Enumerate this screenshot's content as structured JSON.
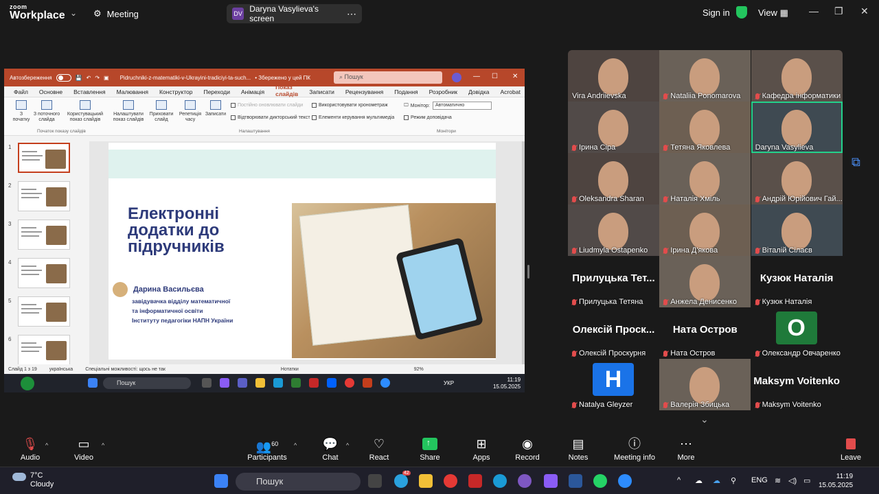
{
  "zoom": {
    "logo_top": "zoom",
    "logo_bottom": "Workplace",
    "meeting_label": "Meeting",
    "share_initials": "DV",
    "share_label": "Daryna Vasylieva's screen",
    "sign_in": "Sign in",
    "view_label": "View"
  },
  "ppt": {
    "autosave": "Автозбереження",
    "doc_title": "Pidruchniki-z-matematiki-v-Ukrayini-tradiciyi-ta-such...",
    "saved": "• Збережено у цей ПК",
    "search": "Пошук",
    "avatar": "ДВ",
    "tabs": [
      "Файл",
      "Основне",
      "Вставлення",
      "Малювання",
      "Конструктор",
      "Переходи",
      "Анімація",
      "Показ слайдів",
      "Записати",
      "Рецензування",
      "Подання",
      "Розробник",
      "Довідка",
      "Acrobat"
    ],
    "active_tab": "Показ слайдів",
    "ribbon": {
      "btn_start": "З початку",
      "btn_current": "З поточного слайда",
      "btn_custom": "Користувацький показ слайдів",
      "btn_setup": "Налаштувати показ слайдів",
      "btn_hide": "Приховати слайд",
      "btn_rehearse": "Репетиція часу",
      "btn_record": "Записати",
      "chk_loop": "Постійно оновлювати слайди",
      "chk_timings": "Використовувати хронометраж",
      "chk_narration": "Відтворювати дикторський текст",
      "chk_media": "Елементи керування мультимедіа",
      "monitor_label": "Монітор:",
      "monitor_value": "Автоматично",
      "presenter": "Режим доповідача",
      "grp_start": "Початок показу слайдів",
      "grp_setup": "Налаштування",
      "grp_monitors": "Монітори"
    },
    "thumbs": [
      "1",
      "2",
      "3",
      "4",
      "5",
      "6"
    ],
    "slide": {
      "title_l1": "Електронні",
      "title_l2": "додатки до",
      "title_l3": "підручників",
      "author": "Дарина Васильєва",
      "desc_l1": "завідувачка відділу математичної",
      "desc_l2": "та інформатичної освіти",
      "desc_l3": "Інституту педагогіки НАПН України"
    },
    "status": {
      "slide_count": "Слайд 1 з 19",
      "language": "українська",
      "accessibility": "Спеціальні можливості: щось не так",
      "notes": "Нотатки",
      "zoom": "92%"
    },
    "taskbar": {
      "search": "Пошук",
      "lang": "УКР",
      "time": "11:19",
      "date": "15.05.2025"
    }
  },
  "participants": [
    {
      "name": "Vira Andriievska",
      "type": "photo",
      "muted": false
    },
    {
      "name": "Nataliia Ponomarova",
      "type": "photo",
      "muted": true
    },
    {
      "name": "Кафедра інформатики",
      "type": "photo",
      "muted": true
    },
    {
      "name": "Ірина Сіра",
      "type": "photo",
      "muted": true
    },
    {
      "name": "Тетяна Яковлева",
      "type": "photo",
      "muted": true
    },
    {
      "name": "Daryna Vasylieva",
      "type": "photo",
      "muted": false
    },
    {
      "name": "Oleksandra Sharan",
      "type": "photo",
      "muted": true
    },
    {
      "name": "Наталія Хміль",
      "type": "photo",
      "muted": true
    },
    {
      "name": "Андрій Юрійович Гай...",
      "type": "photo",
      "muted": true
    },
    {
      "name": "Liudmyla Ostapenko",
      "type": "photo",
      "muted": true
    },
    {
      "name": "Ірина Д'якова",
      "type": "photo",
      "muted": true
    },
    {
      "name": "Віталій Сілаєв",
      "type": "photo",
      "muted": true
    },
    {
      "name": "Прилуцька Тетяна",
      "type": "text",
      "big": "Прилуцька Тет...",
      "muted": true
    },
    {
      "name": "Анжела Денисенко",
      "type": "photo",
      "muted": true
    },
    {
      "name": "Кузюк Наталія",
      "type": "text",
      "big": "Кузюк Наталія",
      "muted": true
    },
    {
      "name": "Олексій Проскурня",
      "type": "text",
      "big": "Олексій Проск...",
      "muted": true
    },
    {
      "name": "Ната Остров",
      "type": "text",
      "big": "Ната Остров",
      "muted": true
    },
    {
      "name": "Олександр Овчаренко",
      "type": "initial",
      "big": "О",
      "color": "#1f7a3a",
      "muted": true
    },
    {
      "name": "Natalya Gleyzer",
      "type": "initial",
      "big": "Н",
      "color": "#1a73e8",
      "muted": true
    },
    {
      "name": "Валерія Збицька",
      "type": "photo",
      "muted": true
    },
    {
      "name": "Maksym Voitenko",
      "type": "text",
      "big": "Maksym Voitenko",
      "muted": true
    }
  ],
  "toolbar": {
    "audio": "Audio",
    "video": "Video",
    "participants": "Participants",
    "participant_count": "60",
    "chat": "Chat",
    "react": "React",
    "share": "Share",
    "apps": "Apps",
    "record": "Record",
    "notes": "Notes",
    "meeting_info": "Meeting info",
    "more": "More",
    "leave": "Leave"
  },
  "windows": {
    "temp": "7°C",
    "weather": "Cloudy",
    "search": "Пошук",
    "lang": "ENG",
    "time": "11:19",
    "date": "15.05.2025",
    "badge": "42"
  },
  "colors": {
    "zoom_green": "#23c55e",
    "ppt_red": "#b7472a",
    "muted_red": "#e24c4c",
    "slide_title": "#2d3a7a"
  }
}
